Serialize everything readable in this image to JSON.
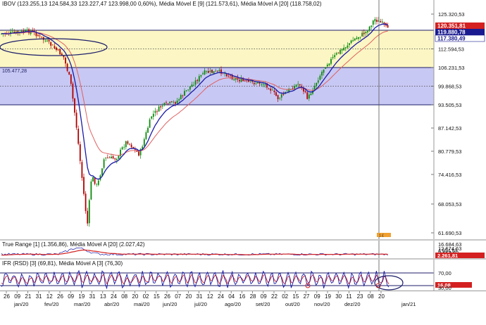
{
  "colors": {
    "bull_candle": "#0a8a0a",
    "bear_candle": "#b00000",
    "ema_line": "#1a1aa8",
    "sma_line": "#e06060",
    "upper_zone": "#fbf6c4",
    "lower_zone": "#c8c8f4",
    "zone_border": "#1c1c6a",
    "current_price_badge": "#d42020",
    "level_badge": "#1a1a90",
    "axis_text": "#111111"
  },
  "main_panel": {
    "title": "IBOV (123.255,13  124.584,33  123.227,47  123.998,00  0,60%), Média Móvel E [9] (121.573,61), Média Móvel A [20] (118.758,02)",
    "price_axis": [
      "125.320,53",
      "112.594,53",
      "106.231,53",
      "99.868,53",
      "93.505,53",
      "87.142,53",
      "80.779,53",
      "74.416,53",
      "68.053,53",
      "61.690,53"
    ],
    "badges": {
      "current_price": "120.351,81",
      "ema9": "119.880,78",
      "sma20": "117.380,49"
    },
    "zone_label": "105.477,28",
    "annotation_marker": "1 £"
  },
  "true_range_panel": {
    "title": "True Range [1] (1.356,86), Média Móvel A [20] (2.027,42)",
    "axis": [
      "16.684,63",
      "12.674,63",
      "8.664,63",
      "4.654,63"
    ],
    "badge": "2.261,81"
  },
  "ifr_panel": {
    "title": "IFR (RSD) [3] (69,81), Média Móvel A [3] (76,30)",
    "axis": [
      "70,00",
      "30,00"
    ],
    "badge": "16,08"
  },
  "x_axis": {
    "days": [
      {
        "label": "26"
      },
      {
        "label": "09"
      },
      {
        "label": "21"
      },
      {
        "label": "31"
      },
      {
        "label": "12"
      },
      {
        "label": "26"
      },
      {
        "label": "09"
      },
      {
        "label": "19"
      },
      {
        "label": "31"
      },
      {
        "label": "13"
      },
      {
        "label": "24"
      },
      {
        "label": "08"
      },
      {
        "label": "20"
      },
      {
        "label": "02"
      },
      {
        "label": "15"
      },
      {
        "label": "26"
      },
      {
        "label": "07"
      },
      {
        "label": "20"
      },
      {
        "label": "31"
      },
      {
        "label": "12"
      },
      {
        "label": "24"
      },
      {
        "label": "04"
      },
      {
        "label": "16"
      },
      {
        "label": "28"
      },
      {
        "label": "09"
      },
      {
        "label": "22"
      },
      {
        "label": "02"
      },
      {
        "label": "15"
      },
      {
        "label": "27"
      },
      {
        "label": "09"
      },
      {
        "label": "19"
      },
      {
        "label": "30"
      },
      {
        "label": "11"
      },
      {
        "label": "23"
      },
      {
        "label": "08"
      },
      {
        "label": "20"
      }
    ],
    "months": [
      {
        "label": "jan/20"
      },
      {
        "label": "fev/20"
      },
      {
        "label": "mar/20"
      },
      {
        "label": "abr/20"
      },
      {
        "label": "mai/20"
      },
      {
        "label": "jun/20"
      },
      {
        "label": "jul/20"
      },
      {
        "label": "ago/20"
      },
      {
        "label": "set/20"
      },
      {
        "label": "out/20"
      },
      {
        "label": "nov/20"
      },
      {
        "label": "dez/20"
      },
      {
        "label": "jan/21"
      }
    ]
  }
}
